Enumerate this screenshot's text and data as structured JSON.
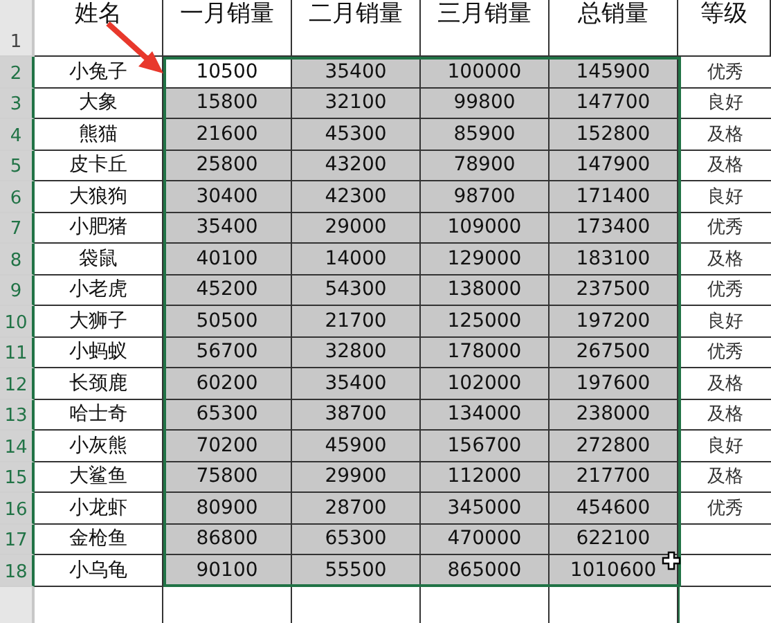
{
  "header": {
    "row_number": "1",
    "columns": [
      "姓名",
      "一月销量",
      "二月销量",
      "三月销量",
      "总销量",
      "等级"
    ]
  },
  "rows": [
    {
      "row_number": "2",
      "name": "小兔子",
      "values": [
        {
          "text": "10500",
          "selected": false
        },
        {
          "text": "35400",
          "selected": true
        },
        {
          "text": "100000",
          "selected": true
        },
        {
          "text": "145900",
          "selected": true
        }
      ],
      "grade": "优秀"
    },
    {
      "row_number": "3",
      "name": "大象",
      "values": [
        {
          "text": "15800",
          "selected": true
        },
        {
          "text": "32100",
          "selected": true
        },
        {
          "text": "99800",
          "selected": true
        },
        {
          "text": "147700",
          "selected": true
        }
      ],
      "grade": "良好"
    },
    {
      "row_number": "4",
      "name": "熊猫",
      "values": [
        {
          "text": "21600",
          "selected": true
        },
        {
          "text": "45300",
          "selected": true
        },
        {
          "text": "85900",
          "selected": true
        },
        {
          "text": "152800",
          "selected": true
        }
      ],
      "grade": "及格"
    },
    {
      "row_number": "5",
      "name": "皮卡丘",
      "values": [
        {
          "text": "25800",
          "selected": true
        },
        {
          "text": "43200",
          "selected": true
        },
        {
          "text": "78900",
          "selected": true
        },
        {
          "text": "147900",
          "selected": true
        }
      ],
      "grade": "及格"
    },
    {
      "row_number": "6",
      "name": "大狼狗",
      "values": [
        {
          "text": "30400",
          "selected": true
        },
        {
          "text": "42300",
          "selected": true
        },
        {
          "text": "98700",
          "selected": true
        },
        {
          "text": "171400",
          "selected": true
        }
      ],
      "grade": "良好"
    },
    {
      "row_number": "7",
      "name": "小肥猪",
      "values": [
        {
          "text": "35400",
          "selected": true
        },
        {
          "text": "29000",
          "selected": true
        },
        {
          "text": "109000",
          "selected": true
        },
        {
          "text": "173400",
          "selected": true
        }
      ],
      "grade": "优秀"
    },
    {
      "row_number": "8",
      "name": "袋鼠",
      "values": [
        {
          "text": "40100",
          "selected": true
        },
        {
          "text": "14000",
          "selected": true
        },
        {
          "text": "129000",
          "selected": true
        },
        {
          "text": "183100",
          "selected": true
        }
      ],
      "grade": "及格"
    },
    {
      "row_number": "9",
      "name": "小老虎",
      "values": [
        {
          "text": "45200",
          "selected": true
        },
        {
          "text": "54300",
          "selected": true
        },
        {
          "text": "138000",
          "selected": true
        },
        {
          "text": "237500",
          "selected": true
        }
      ],
      "grade": "优秀"
    },
    {
      "row_number": "10",
      "name": "大狮子",
      "values": [
        {
          "text": "50500",
          "selected": true
        },
        {
          "text": "21700",
          "selected": true
        },
        {
          "text": "125000",
          "selected": true
        },
        {
          "text": "197200",
          "selected": true
        }
      ],
      "grade": "良好"
    },
    {
      "row_number": "11",
      "name": "小蚂蚁",
      "values": [
        {
          "text": "56700",
          "selected": true
        },
        {
          "text": "32800",
          "selected": true
        },
        {
          "text": "178000",
          "selected": true
        },
        {
          "text": "267500",
          "selected": true
        }
      ],
      "grade": "优秀"
    },
    {
      "row_number": "12",
      "name": "长颈鹿",
      "values": [
        {
          "text": "60200",
          "selected": true
        },
        {
          "text": "35400",
          "selected": true
        },
        {
          "text": "102000",
          "selected": true
        },
        {
          "text": "197600",
          "selected": true
        }
      ],
      "grade": "及格"
    },
    {
      "row_number": "13",
      "name": "哈士奇",
      "values": [
        {
          "text": "65300",
          "selected": true
        },
        {
          "text": "38700",
          "selected": true
        },
        {
          "text": "134000",
          "selected": true
        },
        {
          "text": "238000",
          "selected": true
        }
      ],
      "grade": "及格"
    },
    {
      "row_number": "14",
      "name": "小灰熊",
      "values": [
        {
          "text": "70200",
          "selected": true
        },
        {
          "text": "45900",
          "selected": true
        },
        {
          "text": "156700",
          "selected": true
        },
        {
          "text": "272800",
          "selected": true
        }
      ],
      "grade": "良好"
    },
    {
      "row_number": "15",
      "name": "大鲨鱼",
      "values": [
        {
          "text": "75800",
          "selected": true
        },
        {
          "text": "29900",
          "selected": true
        },
        {
          "text": "112000",
          "selected": true
        },
        {
          "text": "217700",
          "selected": true
        }
      ],
      "grade": "及格"
    },
    {
      "row_number": "16",
      "name": "小龙虾",
      "values": [
        {
          "text": "80900",
          "selected": true
        },
        {
          "text": "28700",
          "selected": true
        },
        {
          "text": "345000",
          "selected": true
        },
        {
          "text": "454600",
          "selected": true
        }
      ],
      "grade": "优秀"
    },
    {
      "row_number": "17",
      "name": "金枪鱼",
      "values": [
        {
          "text": "86800",
          "selected": true
        },
        {
          "text": "65300",
          "selected": true
        },
        {
          "text": "470000",
          "selected": true
        },
        {
          "text": "622100",
          "selected": true
        }
      ]
    },
    {
      "row_number": "18",
      "name": "小乌龟",
      "values": [
        {
          "text": "90100",
          "selected": true
        },
        {
          "text": "55500",
          "selected": true
        },
        {
          "text": "865000",
          "selected": true
        },
        {
          "text": "1010600",
          "selected": true
        }
      ]
    }
  ]
}
